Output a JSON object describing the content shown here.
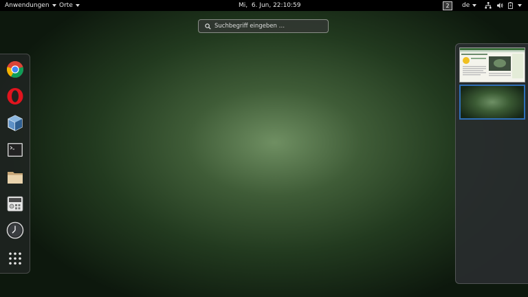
{
  "topbar": {
    "apps_menu": "Anwendungen",
    "places_menu": "Orte",
    "clock": "Mi,  6. Jun, 22:10:59",
    "workspace_number": "2",
    "keyboard_layout": "de"
  },
  "search": {
    "placeholder": "Suchbegriff eingeben …"
  },
  "dash": {
    "apps": [
      {
        "icon": "chrome-icon"
      },
      {
        "icon": "opera-icon"
      },
      {
        "icon": "virtualbox-icon"
      },
      {
        "icon": "terminal-icon"
      },
      {
        "icon": "files-icon"
      },
      {
        "icon": "calculator-icon"
      },
      {
        "icon": "clock-icon"
      },
      {
        "icon": "show-applications-icon"
      }
    ]
  },
  "workspaces": {
    "count": 2,
    "active": 2
  },
  "colors": {
    "accent": "#2f6fb8",
    "topbar": "#000000"
  }
}
